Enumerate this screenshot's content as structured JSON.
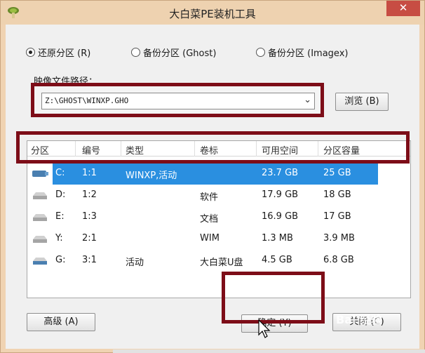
{
  "window": {
    "title": "大白菜PE装机工具",
    "close_label": "✕"
  },
  "mode_options": [
    {
      "label": "还原分区 (R)",
      "checked": true
    },
    {
      "label": "备份分区 (Ghost)",
      "checked": false
    },
    {
      "label": "备份分区 (Imagex)",
      "checked": false
    }
  ],
  "image_path": {
    "label": "映像文件路径：",
    "value": "Z:\\GHOST\\WINXP.GHO",
    "browse_label": "浏览 (B)"
  },
  "partition_table": {
    "columns": [
      "分区",
      "编号",
      "类型",
      "卷标",
      "可用空间",
      "分区容量"
    ],
    "rows": [
      {
        "drive": "C:",
        "num": "1:1",
        "type": "WINXP,活动",
        "label": "",
        "free": "23.7 GB",
        "size": "25 GB",
        "icon": "usb-drive-icon",
        "selected": true
      },
      {
        "drive": "D:",
        "num": "1:2",
        "type": "",
        "label": "软件",
        "free": "17.9 GB",
        "size": "18 GB",
        "icon": "hard-drive-icon",
        "selected": false
      },
      {
        "drive": "E:",
        "num": "1:3",
        "type": "",
        "label": "文档",
        "free": "16.9 GB",
        "size": "17 GB",
        "icon": "hard-drive-icon",
        "selected": false
      },
      {
        "drive": "Y:",
        "num": "2:1",
        "type": "",
        "label": "WIM",
        "free": "1.3 MB",
        "size": "3.9 MB",
        "icon": "hard-drive-icon",
        "selected": false
      },
      {
        "drive": "G:",
        "num": "3:1",
        "type": "活动",
        "label": "大白菜U盘",
        "free": "4.5 GB",
        "size": "6.8 GB",
        "icon": "usb-drive-icon",
        "selected": false
      }
    ]
  },
  "buttons": {
    "advanced": "高级 (A)",
    "ok": "确定 (Y)",
    "close": "关闭 (C)"
  },
  "watermark": "Bai 经验",
  "colors": {
    "selection": "#2a8fe0",
    "highlight_frame": "#7d0d18",
    "titlebar": "#eed2b0",
    "close_button": "#c74d43"
  }
}
